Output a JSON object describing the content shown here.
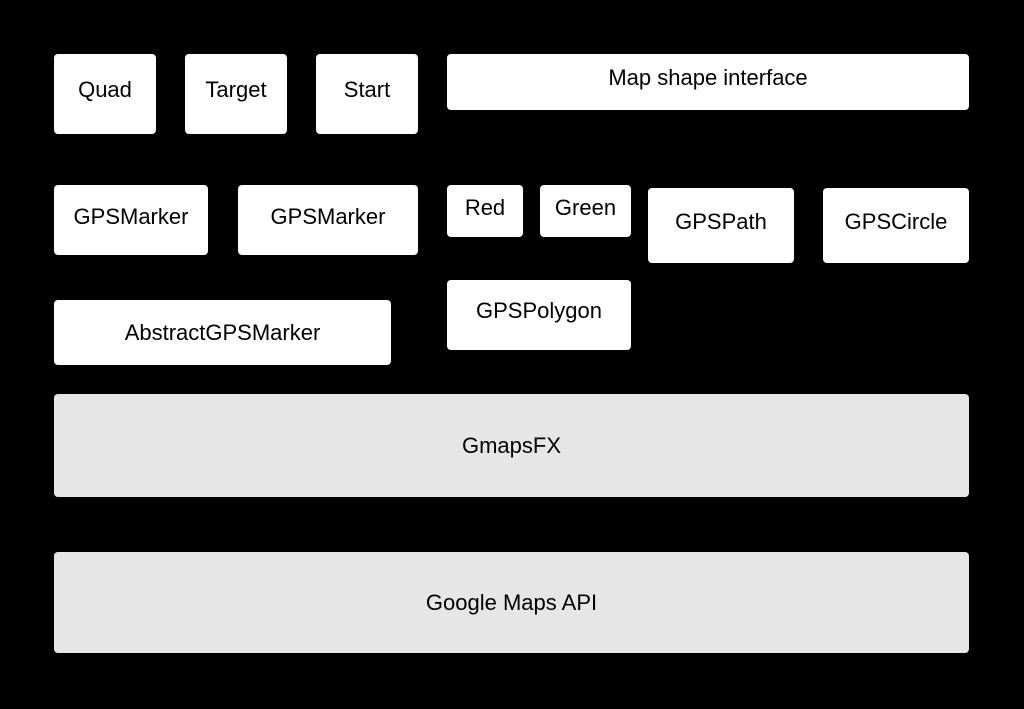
{
  "diagram": {
    "boxes": {
      "quad": "Quad",
      "target": "Target",
      "start": "Start",
      "map_shape_interface": "Map shape interface",
      "gps_marker_1": "GPSMarker",
      "gps_marker_2": "GPSMarker",
      "red": "Red",
      "green": "Green",
      "gps_path": "GPSPath",
      "gps_circle": "GPSCircle",
      "abstract_gps_marker": "AbstractGPSMarker",
      "gps_polygon": "GPSPolygon",
      "gmapsfx": "GmapsFX",
      "google_maps_api": "Google Maps API"
    },
    "colors": {
      "background": "#000000",
      "box": "#ffffff",
      "library_layer": "#e6e6e6"
    }
  }
}
